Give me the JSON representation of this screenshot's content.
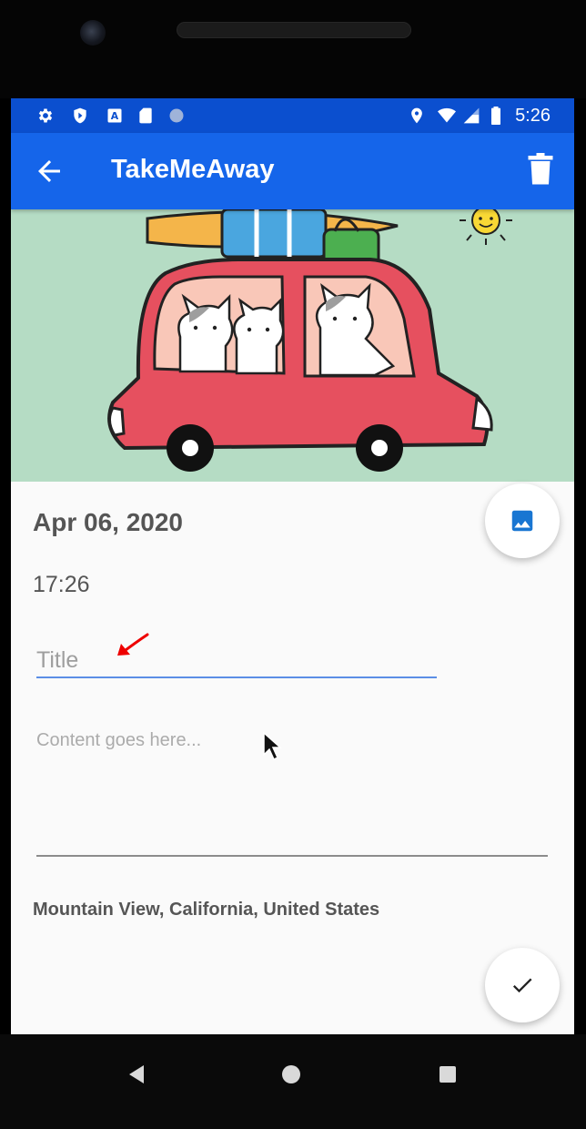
{
  "status_bar": {
    "time": "5:26",
    "left_icons": [
      "settings-icon",
      "shield-icon",
      "a-notification-icon",
      "sd-card-icon",
      "circle-notification-icon"
    ],
    "right_icons": [
      "location-icon",
      "wifi-icon",
      "signal-icon",
      "battery-icon"
    ]
  },
  "app_bar": {
    "title": "TakeMeAway",
    "back_icon": "arrow-back-icon",
    "delete_icon": "trash-icon"
  },
  "entry": {
    "date": "Apr 06, 2020",
    "time": "17:26",
    "title_placeholder": "Title",
    "content_placeholder": "Content goes here...",
    "location": "Mountain View, California, United States"
  },
  "fabs": {
    "image_icon": "image-icon",
    "done_icon": "check-icon"
  },
  "nav_bar": [
    "nav-back-icon",
    "nav-home-icon",
    "nav-recents-icon"
  ],
  "colors": {
    "status_bar": "#0b4fcf",
    "app_bar": "#1565ea",
    "accent": "#1976d2",
    "hero_background": "#b5dcc4",
    "car": "#e6505f"
  }
}
